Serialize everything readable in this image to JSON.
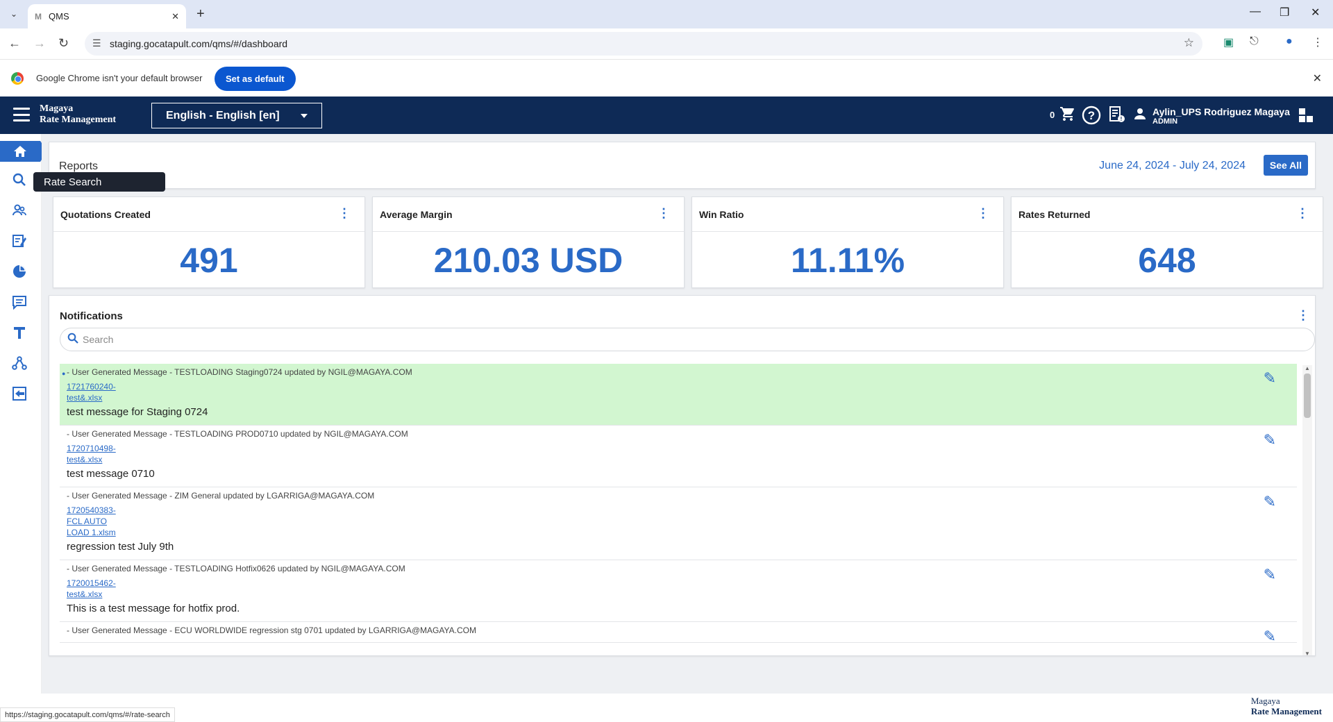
{
  "browser": {
    "tab_title": "QMS",
    "tab_favicon": "M",
    "url": "staging.gocatapult.com/qms/#/dashboard",
    "status_url": "https://staging.gocatapult.com/qms/#/rate-search"
  },
  "infobar": {
    "message": "Google Chrome isn't your default browser",
    "button": "Set as default"
  },
  "header": {
    "brand_line1": "Magaya",
    "brand_line2": "Rate Management",
    "language": "English - English [en]",
    "cart_count": "0",
    "user_name": "Aylin_UPS Rodriguez Magaya",
    "user_role": "ADMIN"
  },
  "sidebar": {
    "tooltip": "Rate Search",
    "items": [
      "home-icon",
      "search-icon",
      "people-icon",
      "edit-note-icon",
      "pie-chart-icon",
      "comment-icon",
      "text-icon",
      "network-icon",
      "logout-icon"
    ]
  },
  "reports": {
    "title": "Reports",
    "date_range": "June 24, 2024 - July 24, 2024",
    "see_all": "See All"
  },
  "kpis": [
    {
      "title": "Quotations Created",
      "value": "491"
    },
    {
      "title": "Average Margin",
      "value": "210.03 USD"
    },
    {
      "title": "Win Ratio",
      "value": "11.11%"
    },
    {
      "title": "Rates Returned",
      "value": "648"
    }
  ],
  "notifications": {
    "title": "Notifications",
    "search_placeholder": "Search",
    "items": [
      {
        "meta": "- User Generated Message - TESTLOADING Staging0724 updated by NGIL@MAGAYA.COM",
        "file": "1721760240-\ntest&.xlsx",
        "body": "test message for Staging 0724",
        "unread": true
      },
      {
        "meta": "- User Generated Message - TESTLOADING PROD0710 updated by NGIL@MAGAYA.COM",
        "file": "1720710498-\ntest&.xlsx",
        "body": "test message 0710",
        "unread": false
      },
      {
        "meta": "- User Generated Message - ZIM General updated by LGARRIGA@MAGAYA.COM",
        "file": "1720540383-\nFCL AUTO\nLOAD 1.xlsm",
        "body": "regression test July 9th",
        "unread": false
      },
      {
        "meta": "- User Generated Message - TESTLOADING Hotfix0626 updated by NGIL@MAGAYA.COM",
        "file": "1720015462-\ntest&.xlsx",
        "body": "This is a test message for hotfix prod.",
        "unread": false
      },
      {
        "meta": "- User Generated Message - ECU WORLDWIDE regression stg 0701 updated by LGARRIGA@MAGAYA.COM",
        "file": "",
        "body": "",
        "unread": false
      }
    ]
  },
  "footer": {
    "brand_line1": "Magaya",
    "brand_line2": "Rate Management"
  },
  "colors": {
    "header_bg": "#0e2a56",
    "accent": "#2a6ac7",
    "unread_bg": "#d2f6d0"
  }
}
